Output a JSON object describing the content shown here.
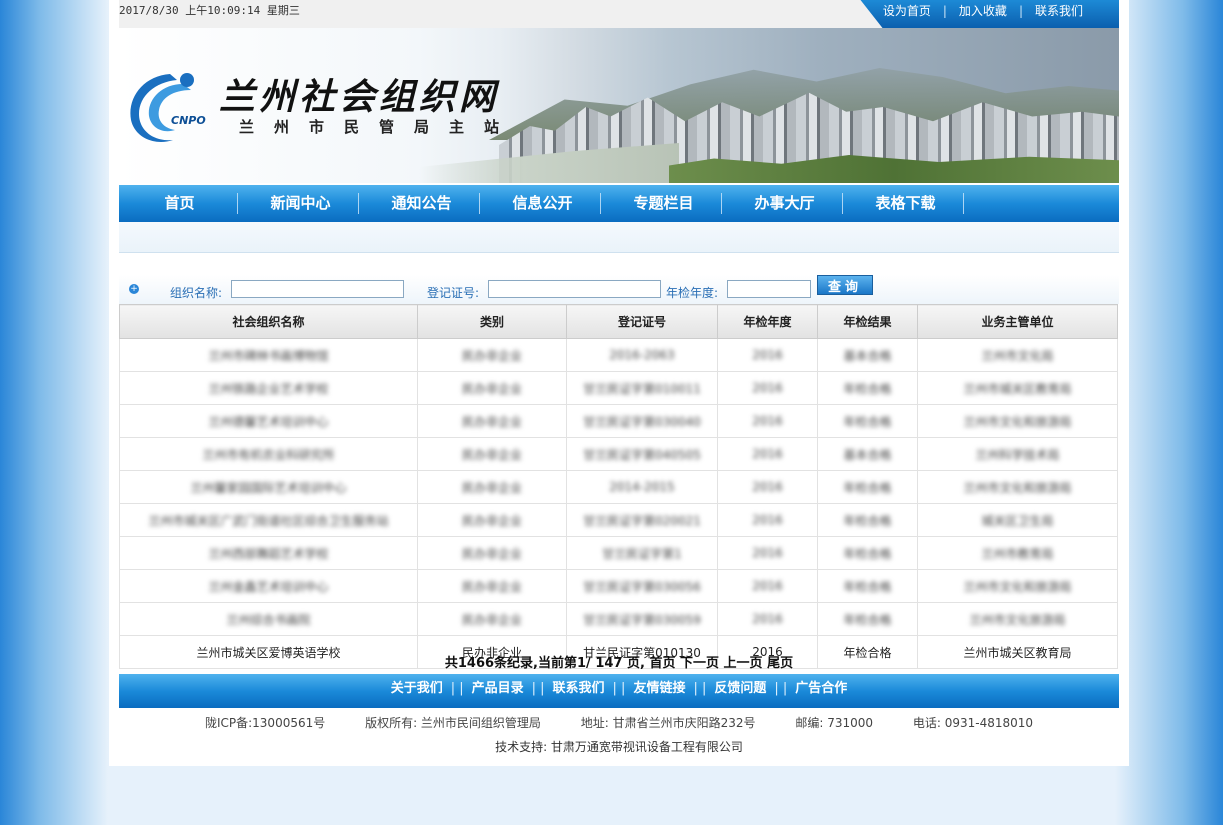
{
  "topbar": {
    "datetime": "2017/8/30 上午10:09:14 星期三",
    "links": [
      "设为首页",
      "加入收藏",
      "联系我们"
    ],
    "separator": "|"
  },
  "banner": {
    "title": "兰州社会组织网",
    "subtitle": "兰州市民管局主站",
    "logo_text": "CNPO"
  },
  "nav": {
    "items": [
      "首页",
      "新闻中心",
      "通知公告",
      "信息公开",
      "专题栏目",
      "办事大厅",
      "表格下载"
    ]
  },
  "search": {
    "name_label": "组织名称:",
    "reg_label": "登记证号:",
    "year_label": "年检年度:",
    "name_value": "",
    "reg_value": "",
    "year_value": "",
    "button": "查询"
  },
  "table": {
    "headers": [
      "社会组织名称",
      "类别",
      "登记证号",
      "年检年度",
      "年检结果",
      "业务主管单位"
    ],
    "blurred_rows": [
      [
        "兰州市碑林书画博物馆",
        "民办非企业",
        "2016-2063",
        "2016",
        "基本合格",
        "兰州市文化局"
      ],
      [
        "兰州铁路企业艺术学校",
        "民办非企业",
        "甘兰民证字第010011",
        "2016",
        "年检合格",
        "兰州市城关区教育局"
      ],
      [
        "兰州德馨艺术培训中心",
        "民办非企业",
        "甘兰民证字第030040",
        "2016",
        "年检合格",
        "兰州市文化和旅游局"
      ],
      [
        "兰州市有机农业科研究所",
        "民办非企业",
        "甘兰民证字第040505",
        "2016",
        "基本合格",
        "兰州科学技术局"
      ],
      [
        "兰州馨家园国际艺术培训中心",
        "民办非企业",
        "2014-2015",
        "2016",
        "年检合格",
        "兰州市文化和旅游局"
      ],
      [
        "兰州市城关区广武门街道社区综合卫生服务站",
        "民办非企业",
        "甘兰民证字第020021",
        "2016",
        "年检合格",
        "城关区卫生局"
      ],
      [
        "兰州西部舞蹈艺术学校",
        "民办非企业",
        "甘兰民证字第1",
        "2016",
        "年检合格",
        "兰州市教育局"
      ],
      [
        "兰州金鑫艺术培训中心",
        "民办非企业",
        "甘兰民证字第030056",
        "2016",
        "年检合格",
        "兰州市文化和旅游局"
      ],
      [
        "兰州综合书画院",
        "民办非企业",
        "甘兰民证字第030059",
        "2016",
        "年检合格",
        "兰州市文化旅游局"
      ]
    ],
    "last_row": [
      "兰州市城关区爱博英语学校",
      "民办非企业",
      "甘兰民证字第010130",
      "2016",
      "年检合格",
      "兰州市城关区教育局"
    ]
  },
  "pager": {
    "summary": "共1466条纪录,当前第1/ 147 页,",
    "first": "首页",
    "next": "下一页",
    "prev": "上一页",
    "last": "尾页"
  },
  "footer": {
    "links": [
      "关于我们",
      "产品目录",
      "联系我们",
      "友情链接",
      "反馈问题",
      "广告合作"
    ],
    "icp": "陇ICP备:13000561号",
    "copyright": "版权所有:  兰州市民间组织管理局",
    "address": "地址: 甘肃省兰州市庆阳路232号",
    "postcode": "邮编: 731000",
    "phone": "电话: 0931-4818010",
    "tech": "技术支持: 甘肃万通宽带视讯设备工程有限公司"
  }
}
